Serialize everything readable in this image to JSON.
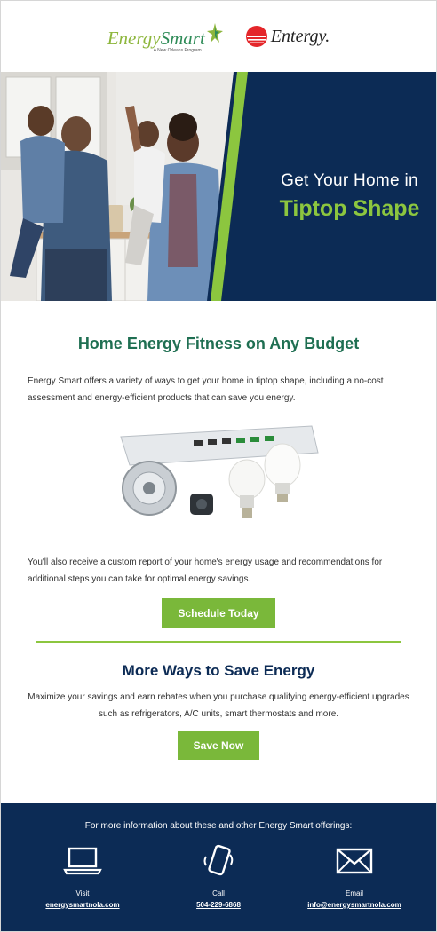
{
  "header": {
    "energy_smart_part1": "Energy",
    "energy_smart_part2": "Smart",
    "energy_smart_tagline": "A New Orleans Program",
    "entergy_name": "Entergy."
  },
  "hero": {
    "line1": "Get Your Home in",
    "line2": "Tiptop Shape"
  },
  "section1": {
    "title": "Home Energy Fitness on Any Budget",
    "intro": "Energy Smart offers a variety of ways to get your home in tiptop shape, including a no-cost assessment and energy-efficient products that can save you energy.",
    "report": "You'll also receive a custom report of your home's energy usage and recommendations for additional steps you can take for optimal energy savings.",
    "button": "Schedule Today"
  },
  "section2": {
    "title": "More Ways to Save Energy",
    "text": "Maximize your savings and earn rebates when you purchase qualifying energy-efficient upgrades such as refrigerators, A/C units, smart thermostats and more.",
    "button": "Save Now"
  },
  "footer": {
    "intro": "For more information about these and other Energy Smart offerings:",
    "contacts": [
      {
        "label": "Visit",
        "value": "energysmartnola.com",
        "icon": "laptop-icon"
      },
      {
        "label": "Call",
        "value": "504-229-6868",
        "icon": "phone-icon"
      },
      {
        "label": "Email",
        "value": "info@energysmartnola.com",
        "icon": "envelope-icon"
      }
    ]
  },
  "colors": {
    "navy": "#0c2b55",
    "green": "#8cc63f",
    "button_green": "#7ab83a",
    "title_green": "#1f6f52"
  }
}
